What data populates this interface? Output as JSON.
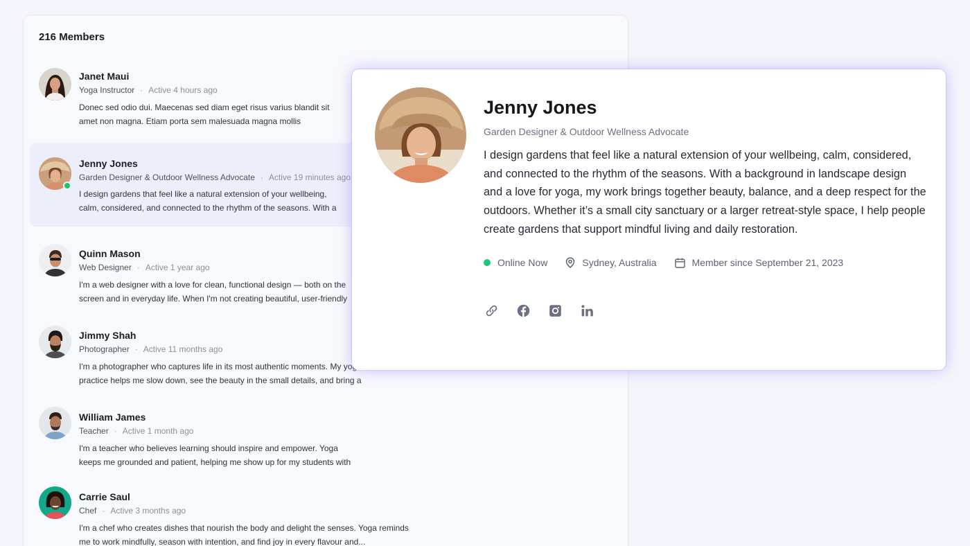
{
  "members": {
    "count_label": "216 Members",
    "list": [
      {
        "name": "Janet Maui",
        "role": "Yoga Instructor",
        "active": "Active 4 hours ago",
        "bio": "Donec sed odio dui. Maecenas sed diam eget risus varius blandit sit amet non magna. Etiam porta sem malesuada magna mollis euismod. Integer posuere erat a ante venenatis dapibus posuere velit aliquet magna..."
      },
      {
        "name": "Jenny Jones",
        "role": "Garden Designer & Outdoor Wellness Advocate",
        "active": "Active 19 minutes ago",
        "bio": "I design gardens that feel like a natural extension of your wellbeing, calm, considered, and connected to the rhythm of the seasons. With a background in landscape design"
      },
      {
        "name": "Quinn Mason",
        "role": "Web Designer",
        "active": "Active 1 year ago",
        "bio": "I'm a web designer with a love for clean, functional design — both on the screen and in everyday life. When I'm not creating beautiful, user-friendly websites, you'll find me"
      },
      {
        "name": "Jimmy Shah",
        "role": "Photographer",
        "active": "Active 11 months ago",
        "bio": "I'm a photographer who captures life in its most authentic moments. My yoga practice helps me slow down, see the beauty in the small details, and bring a sense sense"
      },
      {
        "name": "William James",
        "role": "Teacher",
        "active": "Active 1 month ago",
        "bio": "I'm a teacher who believes learning should inspire and empower. Yoga keeps me grounded and patient, helping me show up for my students with clarity, energy"
      },
      {
        "name": "Carrie Saul",
        "role": "Chef",
        "active": "Active 3 months ago",
        "bio": "I'm a chef who creates dishes that nourish the body and delight the senses. Yoga reminds me to work mindfully, season with intention, and find joy in every flavour and..."
      }
    ]
  },
  "profile": {
    "name": "Jenny Jones",
    "title": "Garden Designer & Outdoor Wellness Advocate",
    "bio": "I design gardens that feel like a natural extension of your wellbeing, calm, considered, and connected to the rhythm of the seasons. With a background in landscape design and a love for yoga, my work brings together beauty, balance, and a deep respect for the outdoors. Whether it’s a small city sanctuary or a larger retreat-style space, I help people create gardens that support mindful living and daily restoration.",
    "status": "Online Now",
    "location": "Sydney, Australia",
    "member_since": "Member since September 21, 2023",
    "social": [
      "link-icon",
      "facebook-icon",
      "instagram-icon",
      "linkedin-icon"
    ]
  },
  "colors": {
    "online": "#20c47a",
    "selected_row": "#eceef9",
    "card_glow": "#8c82ff"
  }
}
